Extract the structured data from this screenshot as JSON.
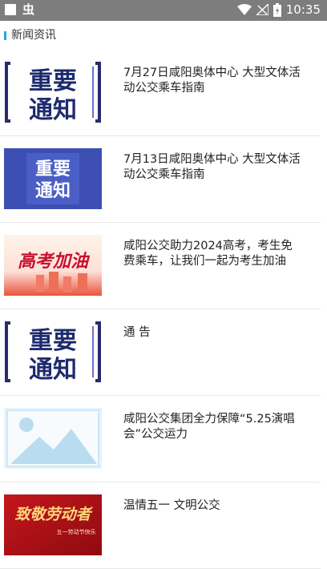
{
  "status_bar": {
    "time": "10:35",
    "icons": [
      "notification-square-icon",
      "bug-icon",
      "wifi-icon",
      "signal-icon",
      "battery-icon"
    ],
    "bug_glyph": "虫"
  },
  "section": {
    "title": "新闻资讯",
    "accent_color": "#29a3e0"
  },
  "news": [
    {
      "title": "7月27日咸阳奥体中心 大型文体活动公交乘车指南",
      "thumb": "notice-white-bg",
      "thumb_text_1": "重要",
      "thumb_text_2": "通知"
    },
    {
      "title": "7月13日咸阳奥体中心 大型文体活动公交乘车指南",
      "thumb": "notice-blue-bg",
      "thumb_text_1": "重要",
      "thumb_text_2": "通知"
    },
    {
      "title": "咸阳公交助力2024高考，考生免费乘车，让我们一起为考生加油",
      "thumb": "gaokao-banner",
      "thumb_text_1": "高考加油"
    },
    {
      "title": "通 告",
      "thumb": "notice-white-bg",
      "thumb_text_1": "重要",
      "thumb_text_2": "通知"
    },
    {
      "title": "咸阳公交集团全力保障“5.25演唱会”公交运力",
      "thumb": "placeholder-image"
    },
    {
      "title": "温情五一 文明公交",
      "thumb": "labor-day-banner",
      "thumb_text_1": "致敬劳动者",
      "thumb_text_2": "五一劳动节快乐"
    }
  ]
}
